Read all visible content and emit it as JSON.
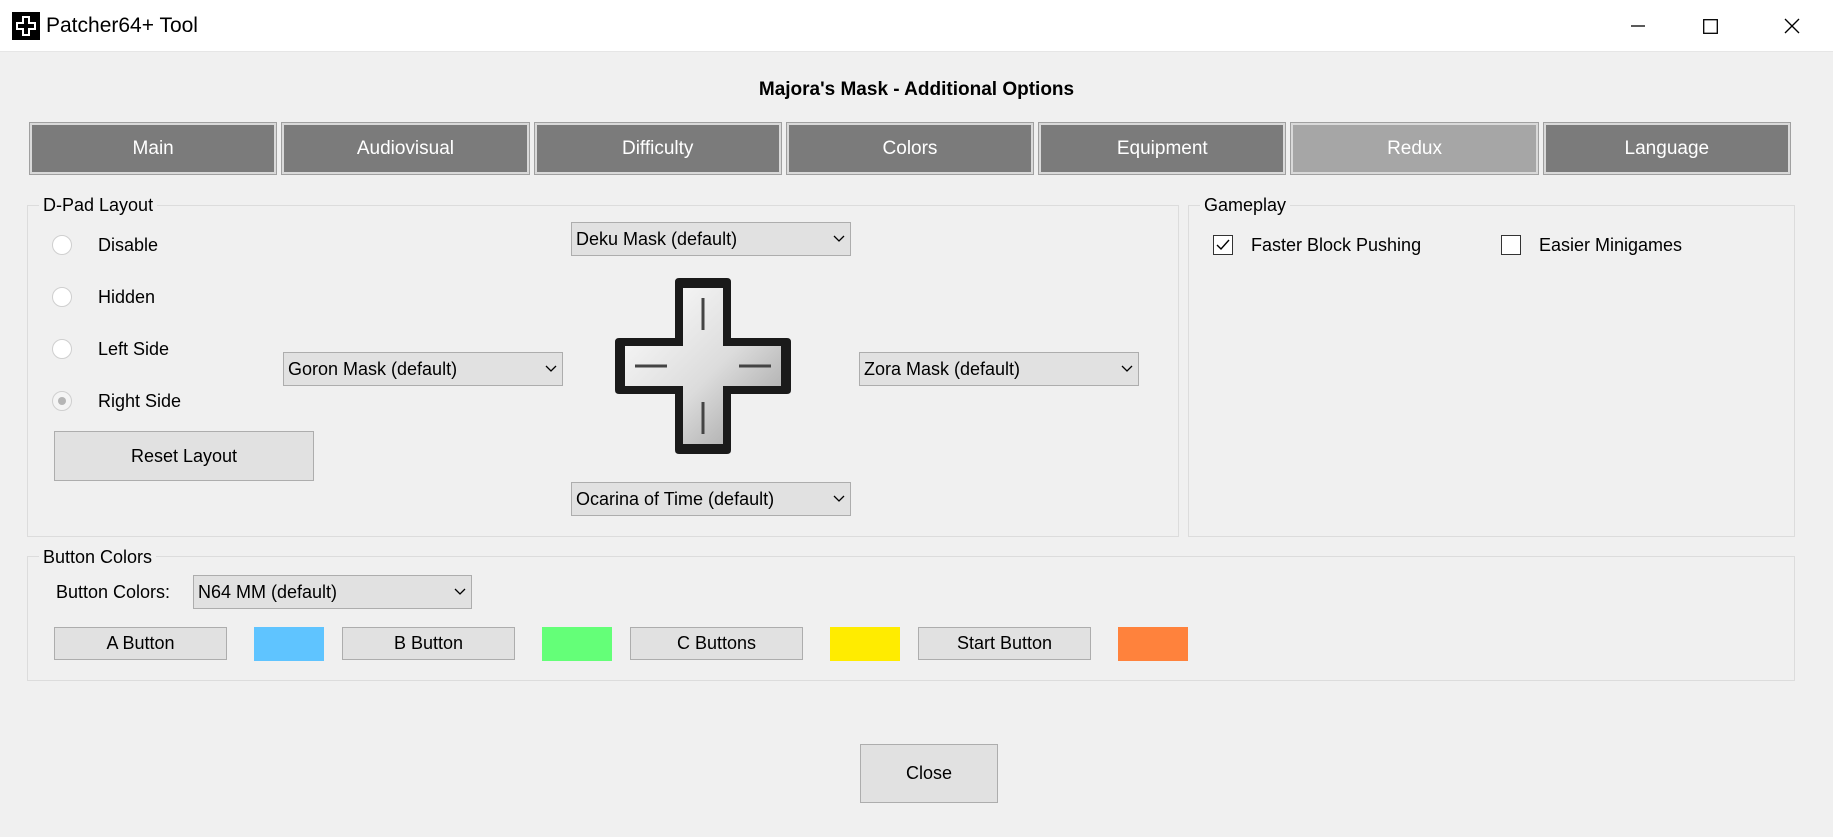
{
  "window": {
    "title": "Patcher64+ Tool",
    "controls": {
      "minimize": "—",
      "maximize": "☐",
      "close": "✕"
    }
  },
  "heading": "Majora's Mask - Additional Options",
  "tabs": [
    {
      "label": "Main",
      "active": false
    },
    {
      "label": "Audiovisual",
      "active": false
    },
    {
      "label": "Difficulty",
      "active": false
    },
    {
      "label": "Colors",
      "active": false
    },
    {
      "label": "Equipment",
      "active": false
    },
    {
      "label": "Redux",
      "active": true
    },
    {
      "label": "Language",
      "active": false
    }
  ],
  "dpad": {
    "group_label": "D-Pad Layout",
    "options": [
      {
        "label": "Disable",
        "checked": false
      },
      {
        "label": "Hidden",
        "checked": false
      },
      {
        "label": "Left Side",
        "checked": false
      },
      {
        "label": "Right Side",
        "checked": true
      }
    ],
    "reset_label": "Reset Layout",
    "up": "Deku Mask (default)",
    "left": "Goron Mask (default)",
    "right": "Zora Mask (default)",
    "down": "Ocarina of Time (default)",
    "icon": "dpad-icon"
  },
  "gameplay": {
    "group_label": "Gameplay",
    "checkboxes": [
      {
        "label": "Faster Block Pushing",
        "checked": true
      },
      {
        "label": "Easier Minigames",
        "checked": false
      }
    ]
  },
  "button_colors": {
    "group_label": "Button Colors",
    "combo_label": "Button Colors:",
    "combo_value": "N64 MM (default)",
    "buttons": [
      {
        "label": "A Button",
        "color": "#5fc4ff"
      },
      {
        "label": "B Button",
        "color": "#64ff78"
      },
      {
        "label": "C Buttons",
        "color": "#ffec00"
      },
      {
        "label": "Start Button",
        "color": "#ff823c"
      }
    ]
  },
  "close_label": "Close"
}
